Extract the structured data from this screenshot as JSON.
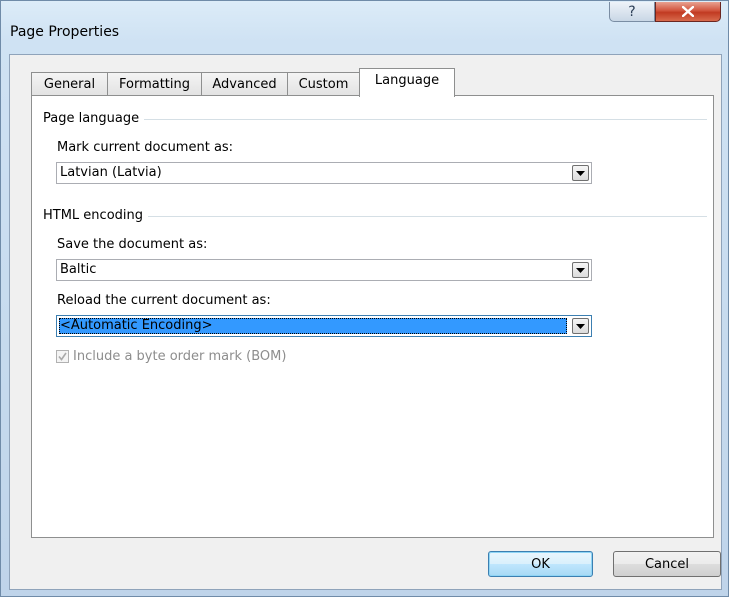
{
  "window": {
    "title": "Page Properties",
    "help_glyph": "?",
    "close_icon": "close-x-icon"
  },
  "tabs": [
    {
      "label": "General",
      "selected": false
    },
    {
      "label": "Formatting",
      "selected": false
    },
    {
      "label": "Advanced",
      "selected": false
    },
    {
      "label": "Custom",
      "selected": false
    },
    {
      "label": "Language",
      "selected": true
    }
  ],
  "page_language": {
    "group_label": "Page language",
    "field_label": "Mark current document as:",
    "value": "Latvian (Latvia)"
  },
  "html_encoding": {
    "group_label": "HTML encoding",
    "save_label": "Save the document as:",
    "save_value": "Baltic",
    "reload_label": "Reload the current document as:",
    "reload_value": "<Automatic Encoding>"
  },
  "bom": {
    "label": "Include a byte order mark (BOM)",
    "checked": true,
    "enabled": false
  },
  "buttons": {
    "ok": "OK",
    "cancel": "Cancel"
  },
  "colors": {
    "selection": "#3399ff",
    "disabled_text": "#8d8d8d",
    "close_button": "#c13a22"
  }
}
